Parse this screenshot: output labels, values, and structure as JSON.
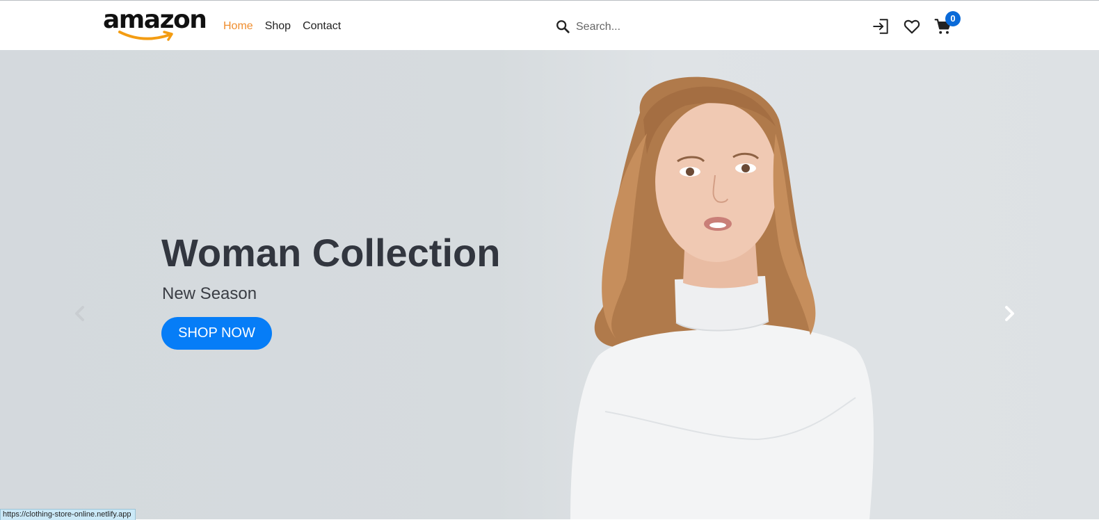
{
  "brand": {
    "logo_text": "amazon",
    "accent_color": "#ef8d2e"
  },
  "nav": {
    "links": [
      {
        "label": "Home",
        "active": true
      },
      {
        "label": "Shop",
        "active": false
      },
      {
        "label": "Contact",
        "active": false
      }
    ]
  },
  "search": {
    "placeholder": "Search...",
    "value": "",
    "icon": "search-icon"
  },
  "header_icons": {
    "login_icon": "login-icon",
    "wishlist_icon": "heart-icon",
    "cart_icon": "cart-icon",
    "cart_count": "0"
  },
  "hero": {
    "title": "Woman Collection",
    "subtitle": "New Season",
    "cta_label": "SHOP NOW",
    "cta_color": "#067df7"
  },
  "carousel": {
    "prev_icon": "chevron-left-icon",
    "next_icon": "chevron-right-icon"
  },
  "status_bar": {
    "url": "https://clothing-store-online.netlify.app"
  }
}
